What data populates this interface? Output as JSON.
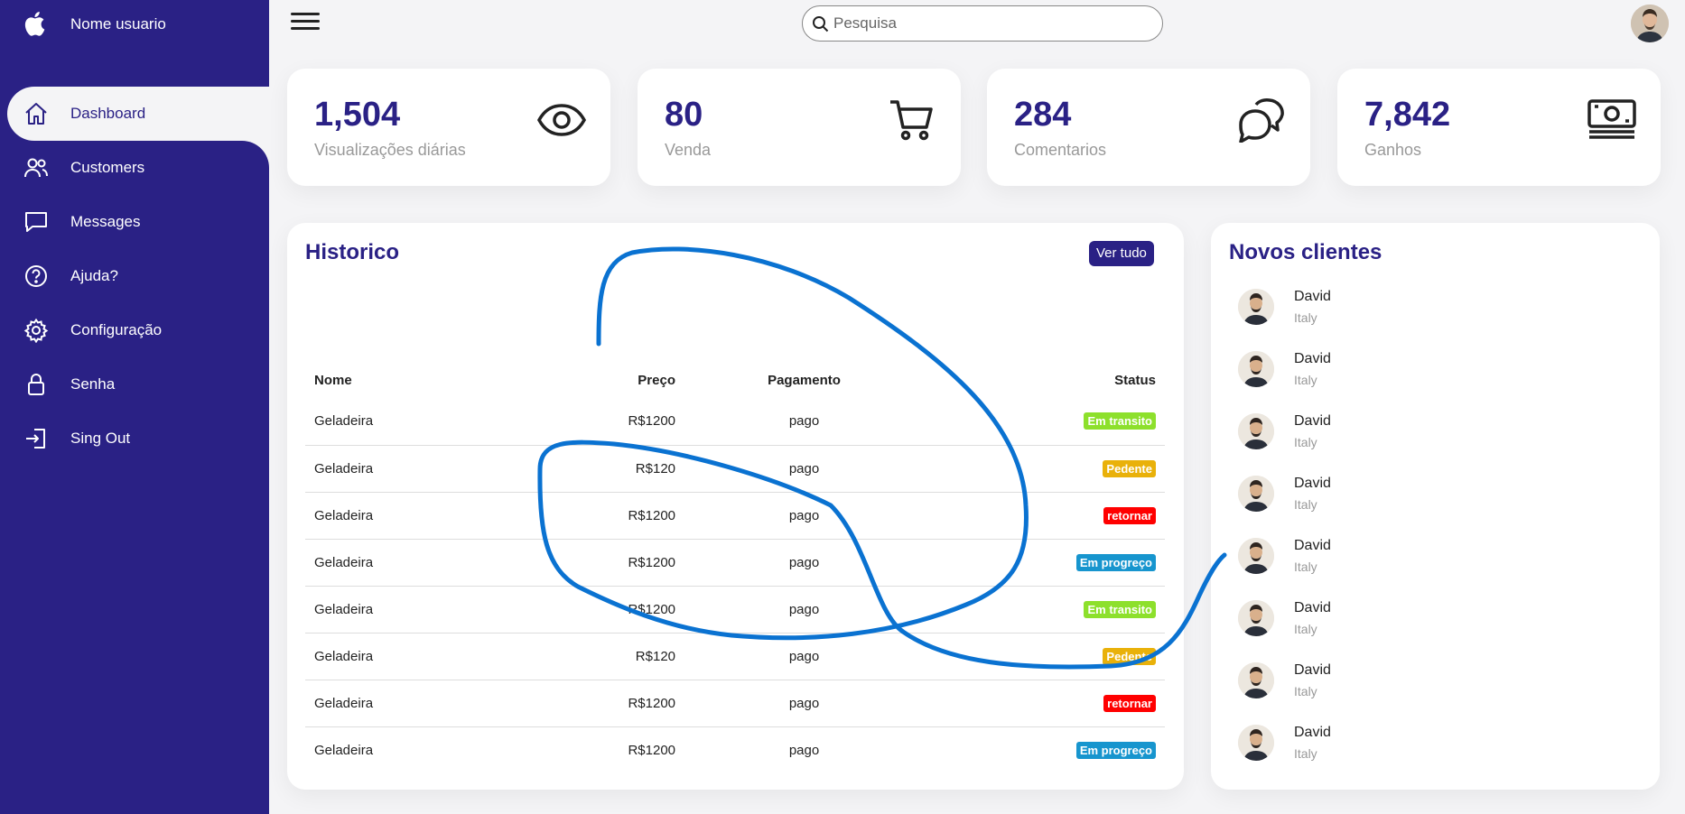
{
  "sidebar": {
    "brand": "Nome usuario",
    "items": [
      {
        "label": "Dashboard",
        "icon": "home-icon",
        "active": true
      },
      {
        "label": "Customers",
        "icon": "people-icon"
      },
      {
        "label": "Messages",
        "icon": "chat-icon"
      },
      {
        "label": "Ajuda?",
        "icon": "help-icon"
      },
      {
        "label": "Configuração",
        "icon": "gear-icon"
      },
      {
        "label": "Senha",
        "icon": "lock-icon"
      },
      {
        "label": "Sing Out",
        "icon": "logout-icon"
      }
    ]
  },
  "topbar": {
    "search_placeholder": "Pesquisa"
  },
  "cards": [
    {
      "number": "1,504",
      "caption": "Visualizações diárias",
      "icon": "eye-icon"
    },
    {
      "number": "80",
      "caption": "Venda",
      "icon": "cart-icon"
    },
    {
      "number": "284",
      "caption": "Comentarios",
      "icon": "chat-bubbles-icon"
    },
    {
      "number": "7,842",
      "caption": "Ganhos",
      "icon": "cash-icon"
    }
  ],
  "historico": {
    "title": "Historico",
    "view_all": "Ver tudo",
    "headers": [
      "Nome",
      "Preço",
      "Pagamento",
      "Status"
    ],
    "rows": [
      {
        "name": "Geladeira",
        "price": "R$1200",
        "payment": "pago",
        "status": "Em transito",
        "color": "#8de02c"
      },
      {
        "name": "Geladeira",
        "price": "R$120",
        "payment": "pago",
        "status": "Pedente",
        "color": "#e9b10a"
      },
      {
        "name": "Geladeira",
        "price": "R$1200",
        "payment": "pago",
        "status": "retornar",
        "color": "#f00"
      },
      {
        "name": "Geladeira",
        "price": "R$1200",
        "payment": "pago",
        "status": "Em progreço",
        "color": "#1795ce"
      },
      {
        "name": "Geladeira",
        "price": "R$1200",
        "payment": "pago",
        "status": "Em transito",
        "color": "#8de02c"
      },
      {
        "name": "Geladeira",
        "price": "R$120",
        "payment": "pago",
        "status": "Pedente",
        "color": "#e9b10a"
      },
      {
        "name": "Geladeira",
        "price": "R$1200",
        "payment": "pago",
        "status": "retornar",
        "color": "#f00"
      },
      {
        "name": "Geladeira",
        "price": "R$1200",
        "payment": "pago",
        "status": "Em progreço",
        "color": "#1795ce"
      }
    ]
  },
  "clientes": {
    "title": "Novos clientes",
    "list": [
      {
        "name": "David",
        "country": "Italy"
      },
      {
        "name": "David",
        "country": "Italy"
      },
      {
        "name": "David",
        "country": "Italy"
      },
      {
        "name": "David",
        "country": "Italy"
      },
      {
        "name": "David",
        "country": "Italy"
      },
      {
        "name": "David",
        "country": "Italy"
      },
      {
        "name": "David",
        "country": "Italy"
      },
      {
        "name": "David",
        "country": "Italy"
      }
    ]
  },
  "colors": {
    "primary": "#2a2185",
    "background": "#f4f4f6",
    "annotation": "#0a72d1"
  }
}
